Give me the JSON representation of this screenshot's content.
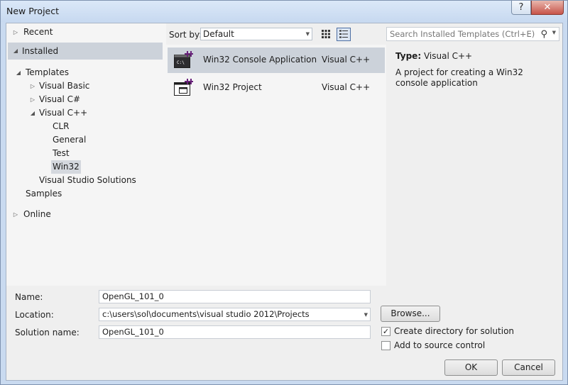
{
  "window": {
    "title": "New Project",
    "help_label": "?",
    "close_label": "✕"
  },
  "nav": {
    "recent": "Recent",
    "installed": "Installed",
    "templates": "Templates",
    "visual_basic": "Visual Basic",
    "visual_csharp": "Visual C#",
    "visual_cpp": "Visual C++",
    "clr": "CLR",
    "general": "General",
    "test": "Test",
    "win32": "Win32",
    "vs_solutions": "Visual Studio Solutions",
    "samples": "Samples",
    "online": "Online"
  },
  "toolbar": {
    "sort_label": "Sort by:",
    "sort_value": "Default"
  },
  "templates": [
    {
      "name": "Win32 Console Application",
      "lang": "Visual C++",
      "selected": true
    },
    {
      "name": "Win32 Project",
      "lang": "Visual C++",
      "selected": false
    }
  ],
  "search": {
    "placeholder": "Search Installed Templates (Ctrl+E)"
  },
  "details": {
    "type_label": "Type:",
    "type_value": "Visual C++",
    "description": "A project for creating a Win32 console application"
  },
  "form": {
    "name_label": "Name:",
    "name_value": "OpenGL_101_0",
    "location_label": "Location:",
    "location_value": "c:\\users\\sol\\documents\\visual studio 2012\\Projects",
    "solution_label": "Solution name:",
    "solution_value": "OpenGL_101_0",
    "browse_label": "Browse...",
    "create_dir_label": "Create directory for solution",
    "create_dir_checked": true,
    "source_control_label": "Add to source control",
    "source_control_checked": false
  },
  "buttons": {
    "ok": "OK",
    "cancel": "Cancel"
  },
  "colors": {
    "selection": "#ccd2da",
    "frame": "#c9daf0",
    "plus_icon": "#68217a"
  }
}
